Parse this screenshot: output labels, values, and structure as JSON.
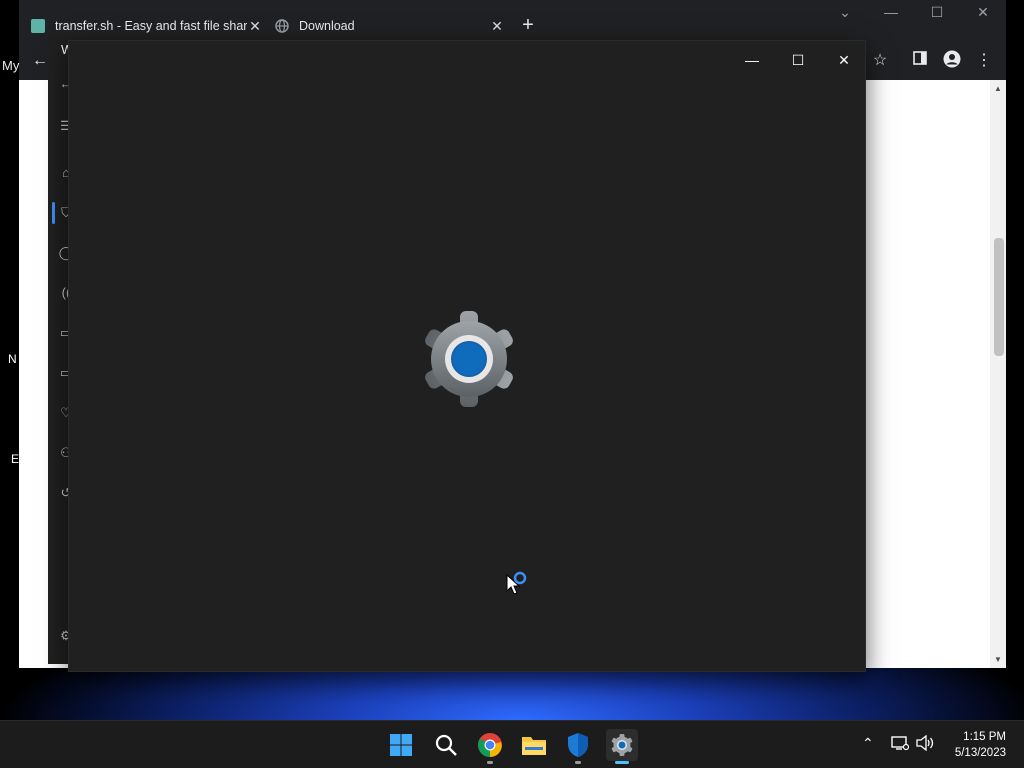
{
  "chrome": {
    "tabs": [
      {
        "title": "transfer.sh - Easy and fast file sharing from the command-line",
        "close": "✕"
      },
      {
        "title": "Download",
        "close": "✕"
      }
    ],
    "new_tab": "+",
    "bookmark_label": "My"
  },
  "settings_back": {
    "title": "Windows Security",
    "nav_icons": [
      "back-arrow-icon",
      "hamburger-icon",
      "home-icon",
      "shield-icon",
      "person-icon",
      "wifi-icon",
      "app-browser-icon",
      "device-security-icon",
      "heart-icon",
      "family-icon",
      "history-icon",
      "gear-icon"
    ]
  },
  "settings_front": {
    "splash_icon": "settings-gear-icon"
  },
  "desktop": {
    "icon_labels": [
      "N",
      "E"
    ]
  },
  "taskbar": {
    "apps": [
      "start-icon",
      "search-icon",
      "chrome-icon",
      "file-explorer-icon",
      "windows-security-icon",
      "settings-icon"
    ],
    "time": "1:15 PM",
    "date": "5/13/2023"
  },
  "colors": {
    "accent": "#3a8ff5",
    "settings_bg": "#202020",
    "taskbar_bg": "#1c1c1c"
  }
}
